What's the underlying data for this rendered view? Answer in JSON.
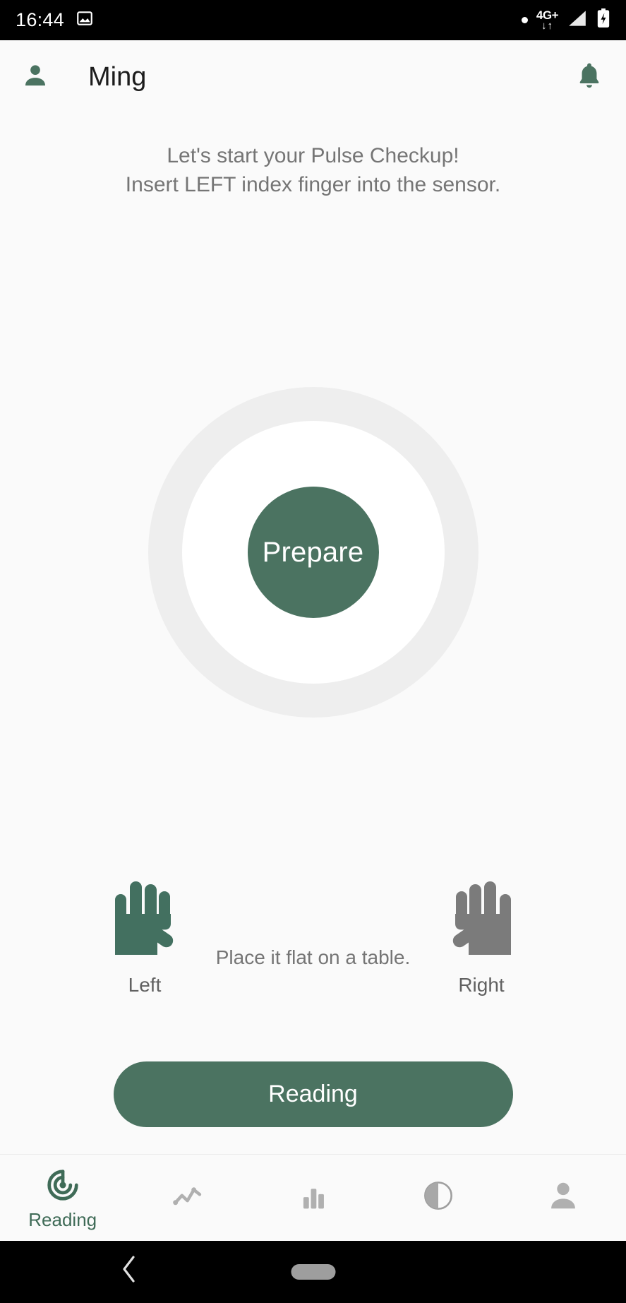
{
  "status_bar": {
    "time": "16:44",
    "left_icons": [
      "image-icon"
    ],
    "right": {
      "dot_icon": "dot-icon",
      "network_label": "4G+",
      "network_arrows": "↓↑",
      "signal_icon": "signal-icon",
      "battery_icon": "battery-charging-icon"
    }
  },
  "app_bar": {
    "profile_icon": "person-icon",
    "title": "Ming",
    "notification_icon": "bell-icon"
  },
  "instruction": {
    "line1": "Let's start your Pulse Checkup!",
    "line2": "Insert LEFT index finger into the sensor."
  },
  "gauge": {
    "status_label": "Prepare"
  },
  "hands": {
    "left_label": "Left",
    "left_icon": "hand-left-icon",
    "center_text": "Place it flat on a table.",
    "right_label": "Right",
    "right_icon": "hand-right-icon"
  },
  "primary_button": {
    "label": "Reading"
  },
  "bottom_nav": {
    "items": [
      {
        "label": "Reading",
        "icon": "pulse-target-icon",
        "active": true
      },
      {
        "label": "",
        "icon": "line-chart-icon",
        "active": false
      },
      {
        "label": "",
        "icon": "bar-chart-icon",
        "active": false
      },
      {
        "label": "",
        "icon": "contrast-icon",
        "active": false
      },
      {
        "label": "",
        "icon": "person-icon",
        "active": false
      }
    ]
  },
  "system_nav": {
    "back_icon": "chevron-left-icon",
    "home_pill": "home-pill"
  },
  "colors": {
    "brand_green": "#4b7361",
    "nav_active_green": "#3f6b57",
    "hand_left_green": "#437060",
    "hand_right_gray": "#7b7b7b",
    "page_background": "#fafafa",
    "gauge_ring": "#eeeeee",
    "text_muted": "#757575"
  }
}
